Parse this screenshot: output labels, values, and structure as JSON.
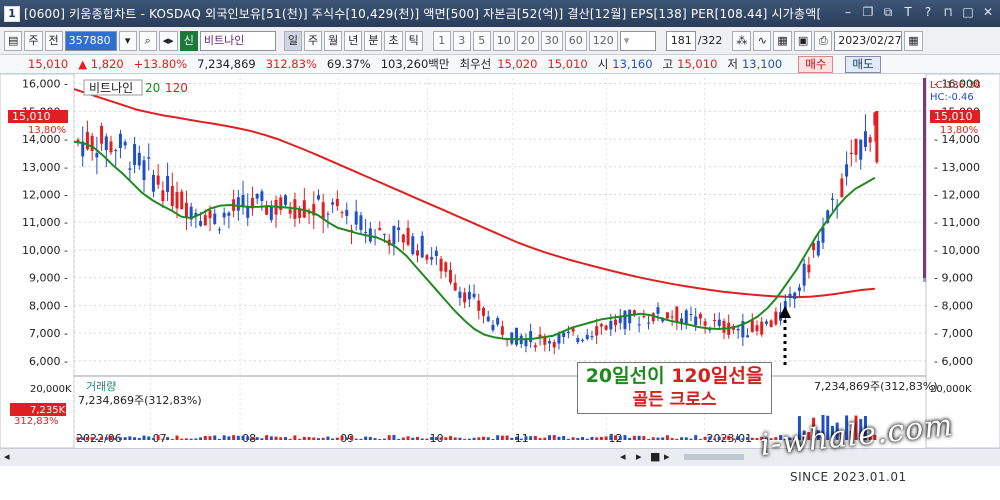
{
  "window": {
    "number": "1",
    "title": "[0600] 키움종합차트 - KOSDAQ 외국인보유[51(천)] 주식수[10,429(천)] 액면[500] 자본금[52(억)] 결산[12월] EPS[138] PER[108.44] 시가총액["
  },
  "toolbar": {
    "mode1": "주",
    "mode2": "전",
    "code": "357880",
    "sin_label": "신",
    "stock_name": "비트나인",
    "periods": [
      "일",
      "주",
      "월",
      "년",
      "분",
      "초",
      "틱"
    ],
    "active_period": "일",
    "minutes": [
      "1",
      "3",
      "5",
      "10",
      "20",
      "30",
      "60",
      "120"
    ],
    "count": "181",
    "total": "/322",
    "date": "2023/02/27"
  },
  "info": {
    "price": "15,010",
    "change": "▲ 1,820",
    "change_pct": "+13.80%",
    "volume": "7,234,869",
    "vol_ratio": "312.83%",
    "rate": "69.37%",
    "amount": "103,260백만",
    "best_label": "최우선",
    "best_ask": "15,020",
    "best_bid": "15,010",
    "open_label": "시",
    "open": "13,160",
    "high_label": "고",
    "high": "15,010",
    "low_label": "저",
    "low": "13,100",
    "buy": "매수",
    "sell": "매도"
  },
  "chart_data": {
    "type": "candlestick",
    "title": "비트나인",
    "legend": [
      {
        "name": "20",
        "color": "#1e8a1e"
      },
      {
        "name": "120",
        "color": "#e02020"
      }
    ],
    "ylim": [
      5600,
      16200
    ],
    "y_ticks": [
      "16,000",
      "15,000",
      "14,000",
      "13,000",
      "12,000",
      "11,000",
      "10,000",
      "9,000",
      "8,000",
      "7,000",
      "6,000"
    ],
    "x_ticks": [
      "2022/06",
      "07",
      "08",
      "09",
      "10",
      "11",
      "12",
      "2023/01"
    ],
    "current_price_label": "15,010",
    "current_pct_label": "13,80%",
    "lc_label": "LC:136.38",
    "hc_label": "HC:-0.46",
    "ma20": [
      13900,
      13850,
      13700,
      13400,
      13050,
      12750,
      12400,
      12050,
      11800,
      11600,
      11420,
      11200,
      11150,
      11300,
      11500,
      11600,
      11620,
      11580,
      11550,
      11560,
      11580,
      11550,
      11520,
      11480,
      11400,
      11250,
      11000,
      10800,
      10700,
      10600,
      10520,
      10450,
      10300,
      10100,
      9800,
      9400,
      9000,
      8600,
      8200,
      7800,
      7450,
      7150,
      6950,
      6850,
      6800,
      6780,
      6780,
      6800,
      6850,
      6900,
      7050,
      7200,
      7300,
      7400,
      7500,
      7550,
      7600,
      7650,
      7700,
      7650,
      7550,
      7450,
      7380,
      7300,
      7220,
      7170,
      7150,
      7180,
      7250,
      7400,
      7600,
      7900,
      8300,
      8800,
      9300,
      9900,
      10500,
      11000,
      11500,
      11900,
      12200,
      12400,
      12600
    ],
    "ma120": [
      15800,
      15650,
      15500,
      15350,
      15200,
      15050,
      14950,
      14850,
      14780,
      14700,
      14620,
      14550,
      14470,
      14380,
      14280,
      14150,
      14000,
      13820,
      13640,
      13450,
      13250,
      13050,
      12850,
      12650,
      12450,
      12250,
      12050,
      11850,
      11650,
      11450,
      11250,
      11050,
      10850,
      10650,
      10450,
      10250,
      10080,
      9920,
      9780,
      9640,
      9520,
      9400,
      9280,
      9170,
      9060,
      8960,
      8870,
      8780,
      8700,
      8630,
      8560,
      8500,
      8450,
      8400,
      8360,
      8330,
      8310,
      8300,
      8320,
      8360,
      8420,
      8490,
      8560,
      8600
    ],
    "volume_axis_label": "20,000K",
    "volume_title": "거래량",
    "volume_text": "7,234,869주(312,83%)",
    "volume_now": "7,235K",
    "volume_pct": "312,83%",
    "callout_line1_green": "20일선이",
    "callout_line1_red": "120일선을",
    "callout_line2": "골든 크로스"
  },
  "watermark": {
    "site": "i-whale.com",
    "since": "SINCE 2023.01.01"
  }
}
